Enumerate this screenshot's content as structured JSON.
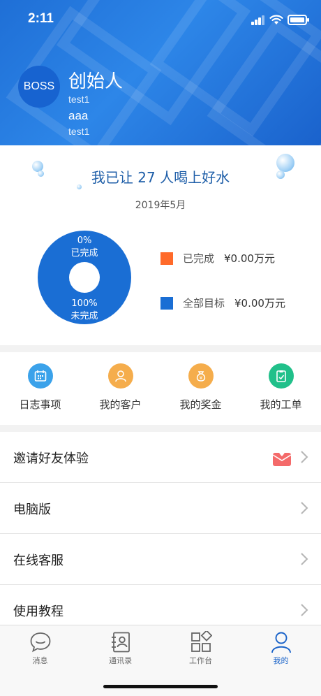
{
  "status": {
    "time": "2:11"
  },
  "profile": {
    "avatar_text": "BOSS",
    "role": "创始人",
    "line1": "test1",
    "line2": "aaa",
    "line3": "test1"
  },
  "progress": {
    "headline": "我已让 27 人喝上好水",
    "month": "2019年5月",
    "donut": {
      "completed_pct": "0%",
      "completed_label": "已完成",
      "remaining_pct": "100%",
      "remaining_label": "未完成"
    },
    "legend": [
      {
        "label": "已完成",
        "amount": "¥0.00万元",
        "color": "#ff6a2a"
      },
      {
        "label": "全部目标",
        "amount": "¥0.00万元",
        "color": "#1a6ed4"
      }
    ]
  },
  "shortcuts": [
    {
      "label": "日志事项",
      "icon": "calendar-icon",
      "color": "#3ba2ea"
    },
    {
      "label": "我的客户",
      "icon": "person-icon",
      "color": "#f5ad4c"
    },
    {
      "label": "我的奖金",
      "icon": "money-bag-icon",
      "color": "#f5ad4c"
    },
    {
      "label": "我的工单",
      "icon": "work-order-icon",
      "color": "#21c08a"
    }
  ],
  "menu": [
    {
      "label": "邀请好友体验",
      "icon": "gift-envelope-icon"
    },
    {
      "label": "电脑版"
    },
    {
      "label": "在线客服"
    },
    {
      "label": "使用教程"
    }
  ],
  "tabs": [
    {
      "label": "消息",
      "icon": "chat-icon"
    },
    {
      "label": "通讯录",
      "icon": "contacts-icon"
    },
    {
      "label": "工作台",
      "icon": "workbench-icon"
    },
    {
      "label": "我的",
      "icon": "profile-icon",
      "active": true
    }
  ],
  "colors": {
    "primary": "#1a6ed4",
    "accent": "#ff6a2a",
    "active_tab": "#1a63c9"
  }
}
